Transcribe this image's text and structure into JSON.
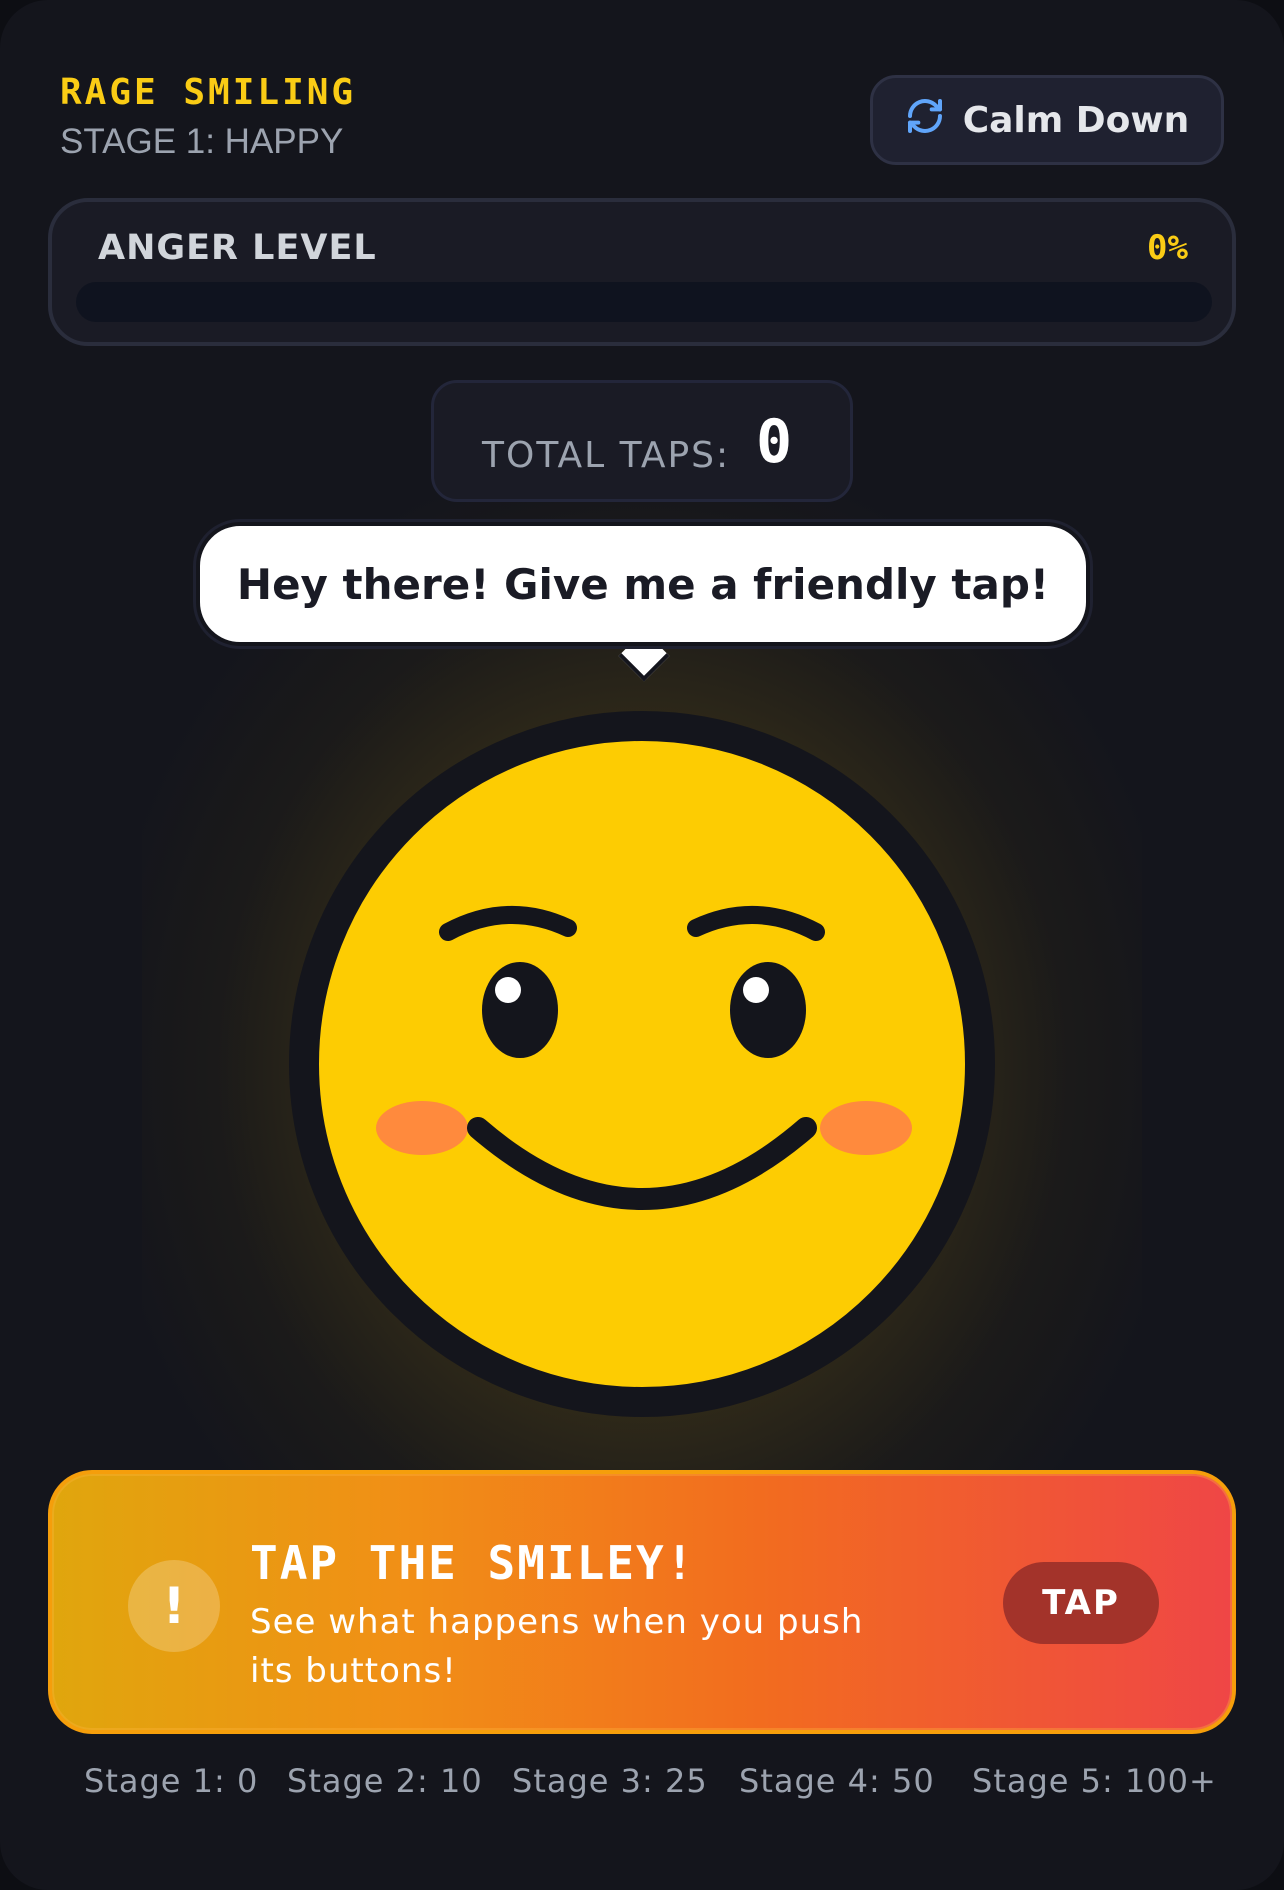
{
  "header": {
    "title": "RAGE SMILING",
    "stage": "STAGE 1: HAPPY",
    "calm_button": "Calm Down",
    "calm_icon": "refresh-icon"
  },
  "anger": {
    "label": "ANGER LEVEL",
    "value_text": "0%",
    "level": 0
  },
  "taps": {
    "label": "TOTAL TAPS:",
    "count": "0"
  },
  "bubble": {
    "text": "Hey there! Give me a friendly tap!"
  },
  "smiley": {
    "face_color": "#fdcc02",
    "outline_color": "#14151c",
    "cheek_color": "#ff8a3d",
    "expression": "happy"
  },
  "cta": {
    "icon": "!",
    "title": "TAP THE SMILEY!",
    "subtitle": "See what happens when you push its buttons!",
    "button": "TAP"
  },
  "stages": [
    "Stage 1: 0",
    "Stage 2: 10",
    "Stage 3: 25",
    "Stage 4: 50",
    "Stage 5: 100+"
  ],
  "colors": {
    "accent": "#facc15",
    "background": "#14151c"
  }
}
